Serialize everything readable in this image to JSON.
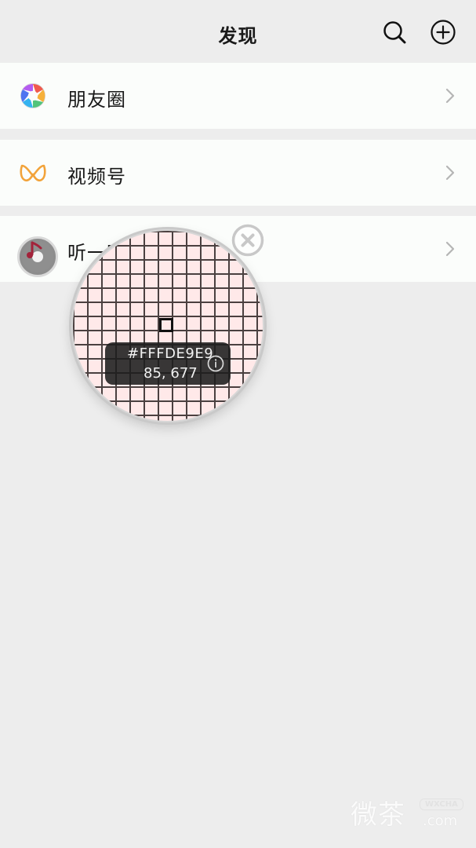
{
  "header": {
    "title": "发现",
    "icons": [
      "search-icon",
      "add-icon"
    ]
  },
  "rows": [
    {
      "label": "朋友圈",
      "icon": "moments-icon"
    },
    {
      "label": "视频号",
      "icon": "channels-icon"
    },
    {
      "label": "听一听",
      "icon": "music-disc-icon"
    }
  ],
  "magnifier": {
    "hex": "#FFFDE9E9",
    "coords": "85, 677",
    "sample_color": "#FFDE9E9",
    "icons": [
      "info-icon",
      "close-icon"
    ]
  },
  "watermark": {
    "main": "微茶",
    "badge": "WXCHA",
    "domain": ".com"
  },
  "colors": {
    "background": "#ededed",
    "row_background": "#fbfdfb",
    "text": "#191919",
    "chevron": "#b5b5b5",
    "channels_orange": "#f2a33a",
    "music_red": "#a3223a"
  }
}
